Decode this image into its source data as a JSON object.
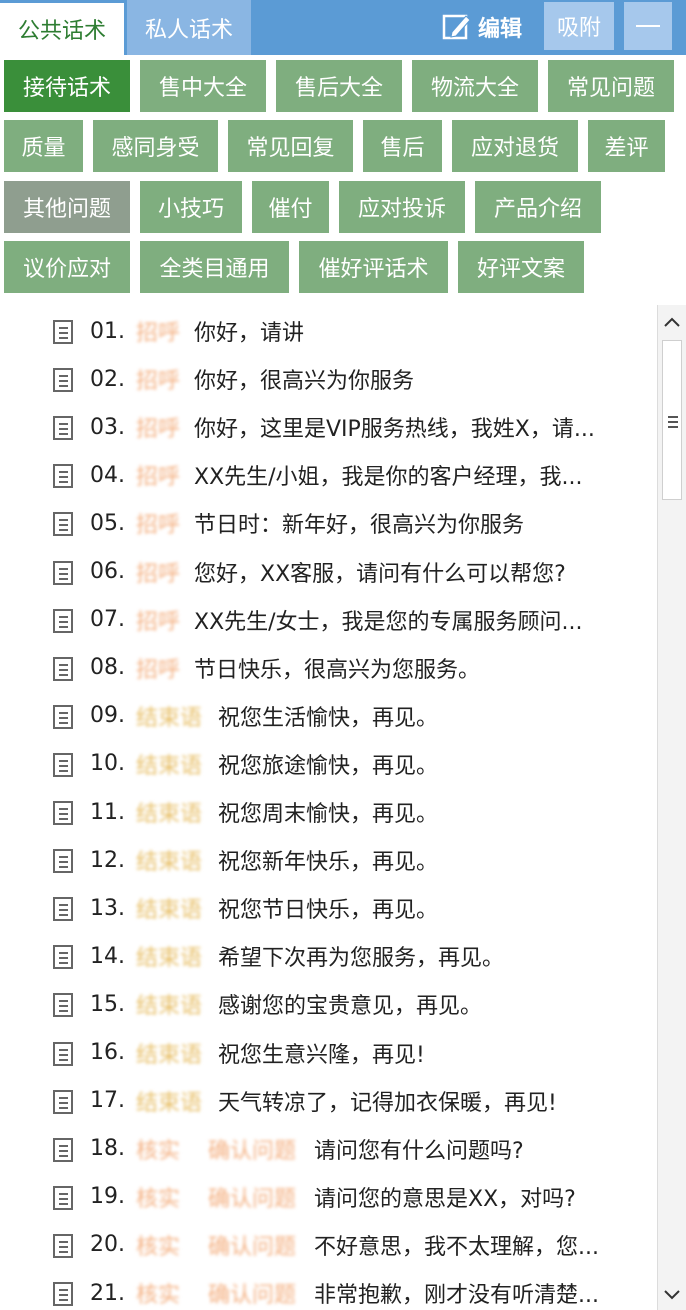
{
  "tabs": {
    "public": "公共话术",
    "private": "私人话术"
  },
  "toolbar": {
    "edit_label": "编辑",
    "pin_label": "吸附"
  },
  "categories": [
    {
      "label": "接待话术",
      "state": "active"
    },
    {
      "label": "售中大全",
      "state": "normal"
    },
    {
      "label": "售后大全",
      "state": "normal"
    },
    {
      "label": "物流大全",
      "state": "normal"
    },
    {
      "label": "常见问题",
      "state": "normal"
    },
    {
      "label": "质量",
      "state": "normal"
    },
    {
      "label": "感同身受",
      "state": "normal"
    },
    {
      "label": "常见回复",
      "state": "normal"
    },
    {
      "label": "售后",
      "state": "normal"
    },
    {
      "label": "应对退货",
      "state": "normal"
    },
    {
      "label": "差评",
      "state": "normal"
    },
    {
      "label": "其他问题",
      "state": "selected"
    },
    {
      "label": "小技巧",
      "state": "normal"
    },
    {
      "label": "催付",
      "state": "normal"
    },
    {
      "label": "应对投诉",
      "state": "normal"
    },
    {
      "label": "产品介绍",
      "state": "normal"
    },
    {
      "label": "议价应对",
      "state": "normal"
    },
    {
      "label": "全类目通用",
      "state": "normal"
    },
    {
      "label": "催好评话术",
      "state": "normal"
    },
    {
      "label": "好评文案",
      "state": "normal"
    }
  ],
  "scripts": [
    {
      "num": "01.",
      "tag": "招呼",
      "tag2": "",
      "text": "你好，请讲"
    },
    {
      "num": "02.",
      "tag": "招呼",
      "tag2": "",
      "text": "你好，很高兴为你服务"
    },
    {
      "num": "03.",
      "tag": "招呼",
      "tag2": "",
      "text": "你好，这里是VIP服务热线，我姓X，请..."
    },
    {
      "num": "04.",
      "tag": "招呼",
      "tag2": "",
      "text": "XX先生/小姐，我是你的客户经理，我..."
    },
    {
      "num": "05.",
      "tag": "招呼",
      "tag2": "",
      "text": "节日时：新年好，很高兴为你服务"
    },
    {
      "num": "06.",
      "tag": "招呼",
      "tag2": "",
      "text": "您好，XX客服，请问有什么可以帮您?"
    },
    {
      "num": "07.",
      "tag": "招呼",
      "tag2": "",
      "text": "XX先生/女士，我是您的专属服务顾问..."
    },
    {
      "num": "08.",
      "tag": "招呼",
      "tag2": "",
      "text": "节日快乐，很高兴为您服务。"
    },
    {
      "num": "09.",
      "tag": "结束语",
      "tag2": "",
      "text": "祝您生活愉快，再见。"
    },
    {
      "num": "10.",
      "tag": "结束语",
      "tag2": "",
      "text": "祝您旅途愉快，再见。"
    },
    {
      "num": "11.",
      "tag": "结束语",
      "tag2": "",
      "text": "祝您周末愉快，再见。"
    },
    {
      "num": "12.",
      "tag": "结束语",
      "tag2": "",
      "text": "祝您新年快乐，再见。"
    },
    {
      "num": "13.",
      "tag": "结束语",
      "tag2": "",
      "text": "祝您节日快乐，再见。"
    },
    {
      "num": "14.",
      "tag": "结束语",
      "tag2": "",
      "text": "希望下次再为您服务，再见。"
    },
    {
      "num": "15.",
      "tag": "结束语",
      "tag2": "",
      "text": "感谢您的宝贵意见，再见。"
    },
    {
      "num": "16.",
      "tag": "结束语",
      "tag2": "",
      "text": "祝您生意兴隆，再见!"
    },
    {
      "num": "17.",
      "tag": "结束语",
      "tag2": "",
      "text": "天气转凉了，记得加衣保暖，再见!"
    },
    {
      "num": "18.",
      "tag": "核实",
      "tag2": "确认问题",
      "text": "请问您有什么问题吗?"
    },
    {
      "num": "19.",
      "tag": "核实",
      "tag2": "确认问题",
      "text": "请问您的意思是XX，对吗?"
    },
    {
      "num": "20.",
      "tag": "核实",
      "tag2": "确认问题",
      "text": "不好意思，我不太理解，您..."
    },
    {
      "num": "21.",
      "tag": "核实",
      "tag2": "确认问题",
      "text": "非常抱歉，刚才没有听清楚..."
    }
  ],
  "icons": {
    "edit": "edit-icon",
    "minimize": "minimize-icon",
    "script_item": "document-icon",
    "scroll_up": "chevron-up-icon",
    "scroll_down": "chevron-down-icon"
  },
  "colors": {
    "header": "#5b9bd5",
    "category": "#7fae7f",
    "category_active": "#3a8f3a",
    "tag": "#f4b183"
  }
}
